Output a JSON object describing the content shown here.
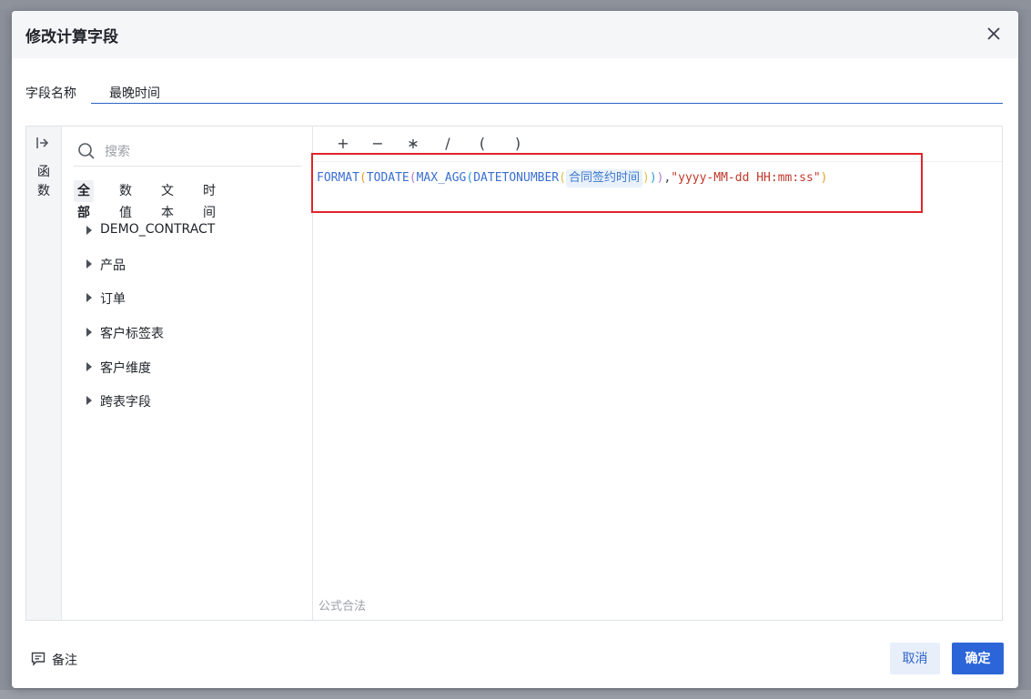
{
  "dialog": {
    "title": "修改计算字段",
    "close_icon": "close-icon"
  },
  "field_name": {
    "label": "字段名称",
    "value": "最晚时间"
  },
  "side_rail": {
    "toggle_icon": "collapse-arrow-icon",
    "label": "函数"
  },
  "search": {
    "placeholder": "搜索",
    "icon": "search-icon"
  },
  "type_tabs": [
    {
      "label": "全部",
      "active": true
    },
    {
      "label": "数值",
      "active": false
    },
    {
      "label": "文本",
      "active": false
    },
    {
      "label": "时间",
      "active": false
    }
  ],
  "tree_items": [
    {
      "label": "DEMO_CONTRACT"
    },
    {
      "label": "产品"
    },
    {
      "label": "订单"
    },
    {
      "label": "客户标签表"
    },
    {
      "label": "客户维度"
    },
    {
      "label": "跨表字段"
    }
  ],
  "operators": [
    "+",
    "−",
    "∗",
    "/",
    "(",
    ")"
  ],
  "formula": {
    "fn_format": "FORMAT",
    "fn_todate": "TODATE",
    "fn_max_agg": "MAX_AGG",
    "fn_datetonumber": "DATETONUMBER",
    "field_token": "合同签约时间",
    "format_string": "\"yyyy-MM-dd HH:mm:ss\"",
    "status": "公式合法"
  },
  "footer": {
    "remark_label": "备注",
    "cancel_label": "取消",
    "ok_label": "确定"
  },
  "colors": {
    "accent": "#2c65d8",
    "highlight_border": "#e0252b",
    "function_blue": "#3b6fd1",
    "string_red": "#c0392b"
  }
}
